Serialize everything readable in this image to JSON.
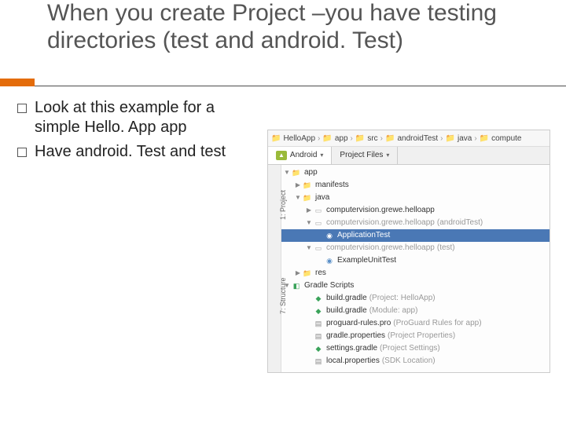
{
  "title": "When you create Project –you have testing directories (test and android. Test)",
  "bullets": [
    "Look at this example for a simple Hello. App app",
    "Have android. Test and test"
  ],
  "breadcrumb": [
    "HelloApp",
    "app",
    "src",
    "androidTest",
    "java",
    "compute"
  ],
  "tabs": {
    "active": "Android",
    "other": "Project Files"
  },
  "side_tabs": {
    "project": "1: Project",
    "structure": "7: Structure"
  },
  "tree": {
    "app": "app",
    "manifests": "manifests",
    "java": "java",
    "pkg_main": "computervision.grewe.helloapp",
    "pkg_android_test": "computervision.grewe.helloapp",
    "pkg_android_test_annot": "(androidTest)",
    "application_test": "ApplicationTest",
    "pkg_test": "computervision.grewe.helloapp",
    "pkg_test_annot": "(test)",
    "example_unit_test": "ExampleUnitTest",
    "res": "res",
    "gradle_scripts": "Gradle Scripts",
    "build_gradle_project": "build.gradle",
    "build_gradle_project_annot": "(Project: HelloApp)",
    "build_gradle_module": "build.gradle",
    "build_gradle_module_annot": "(Module: app)",
    "proguard": "proguard-rules.pro",
    "proguard_annot": "(ProGuard Rules for app)",
    "gradle_props": "gradle.properties",
    "gradle_props_annot": "(Project Properties)",
    "settings_gradle": "settings.gradle",
    "settings_gradle_annot": "(Project Settings)",
    "local_props": "local.properties",
    "local_props_annot": "(SDK Location)"
  }
}
